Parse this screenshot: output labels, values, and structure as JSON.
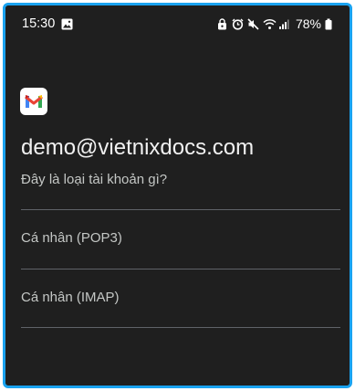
{
  "status_bar": {
    "time": "15:30",
    "battery_percent": "78%",
    "icons": [
      "gallery-icon",
      "alarm-clock-icon",
      "mute-icon",
      "wifi-icon",
      "signal-icon",
      "battery-icon"
    ]
  },
  "app": {
    "logo": "gmail-logo-icon",
    "account_email": "demo@vietnixdocs.com",
    "question": "Đây là loại tài khoản gì?",
    "options": [
      {
        "label": "Cá nhân (POP3)"
      },
      {
        "label": "Cá nhân (IMAP)"
      }
    ]
  },
  "colors": {
    "background": "#1f1f1f",
    "frame_border": "#1aa3f0",
    "divider": "#5f6368"
  }
}
